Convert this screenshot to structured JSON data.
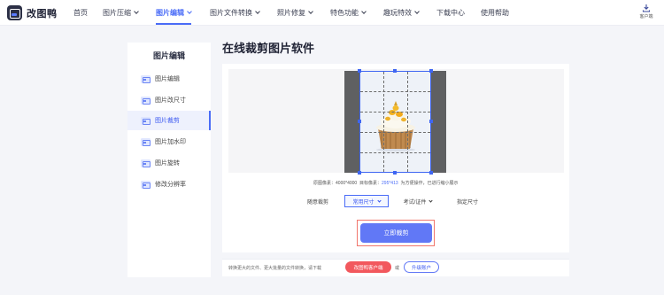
{
  "app": {
    "name": "改图鸭"
  },
  "nav": {
    "items": [
      {
        "label": "首页",
        "has_dropdown": false,
        "active": false
      },
      {
        "label": "图片压缩",
        "has_dropdown": true,
        "active": false
      },
      {
        "label": "图片编辑",
        "has_dropdown": true,
        "active": true
      },
      {
        "label": "图片文件转换",
        "has_dropdown": true,
        "active": false
      },
      {
        "label": "照片修复",
        "has_dropdown": true,
        "active": false
      },
      {
        "label": "特色功能",
        "has_dropdown": true,
        "active": false
      },
      {
        "label": "趣玩特效",
        "has_dropdown": true,
        "active": false
      },
      {
        "label": "下载中心",
        "has_dropdown": false,
        "active": false
      },
      {
        "label": "使用帮助",
        "has_dropdown": false,
        "active": false
      }
    ],
    "client_label": "客户端"
  },
  "sidebar": {
    "title": "图片编辑",
    "items": [
      {
        "label": "图片编辑",
        "active": false
      },
      {
        "label": "图片改尺寸",
        "active": false
      },
      {
        "label": "图片裁剪",
        "active": true
      },
      {
        "label": "图片加水印",
        "active": false
      },
      {
        "label": "图片旋转",
        "active": false
      },
      {
        "label": "修改分辨率",
        "active": false
      }
    ]
  },
  "main": {
    "title": "在线裁剪图片软件",
    "info": {
      "original_label": "原图像素：",
      "original_value": "4000*4000",
      "target_label": "目标像素：",
      "target_value": "295*413",
      "note": "为方便操作，已进行缩小展示"
    },
    "options": [
      {
        "label": "随意裁剪",
        "has_dropdown": false,
        "active": false
      },
      {
        "label": "常用尺寸",
        "has_dropdown": true,
        "active": true
      },
      {
        "label": "考试/证件",
        "has_dropdown": true,
        "active": false
      },
      {
        "label": "指定尺寸",
        "has_dropdown": false,
        "active": false
      }
    ],
    "crop_button": "立即裁剪"
  },
  "footer": {
    "text": "转换更大的文件、更大批量的文件转换，请下载",
    "download_button": "改图鸭客户端",
    "or": "或",
    "upgrade_button": "升级账户"
  },
  "colors": {
    "accent": "#4a6cf7",
    "button": "#6178f6",
    "red": "#f2585d",
    "highlight_frame": "#f1766d"
  }
}
